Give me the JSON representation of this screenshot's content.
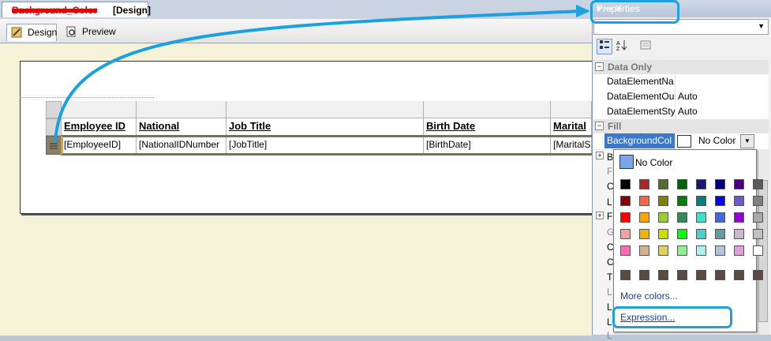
{
  "document": {
    "tab_redacted": "Background_Color",
    "tab_title": "[Design]"
  },
  "subtabs": {
    "design": "Design",
    "preview": "Preview"
  },
  "table": {
    "headers": [
      "Employee ID",
      "National",
      "Job Title",
      "Birth Date",
      "Marital"
    ],
    "cells": [
      "[EmployeeID]",
      "[NationalIDNumber",
      "[JobTitle]",
      "[BirthDate]",
      "[MaritalS"
    ]
  },
  "properties": {
    "title": "Properties",
    "pin_glyph": "▾ ⊸ ✕",
    "combo_arrow": "▼",
    "categories": {
      "data_only": "Data Only",
      "fill": "Fill"
    },
    "rows": [
      {
        "name": "DataElementNa",
        "value": ""
      },
      {
        "name": "DataElementOu",
        "value": "Auto"
      },
      {
        "name": "DataElementSty",
        "value": "Auto"
      }
    ],
    "background_row": {
      "name": "BackgroundCol",
      "value": "No Color"
    },
    "collapsed_letters": [
      "B",
      "F",
      "C",
      "L",
      "F",
      "G",
      "C",
      "C",
      "T",
      "L",
      "L",
      "L",
      "L"
    ]
  },
  "picker": {
    "no_color": "No Color",
    "more_colors": "More colors...",
    "expression": "Expression...",
    "swatches": [
      [
        "#000000",
        "#a52a2a",
        "#556b2f",
        "#006400",
        "#191970",
        "#000080",
        "#4b0082",
        "#595959"
      ],
      [
        "#8b0000",
        "#ff6347",
        "#808000",
        "#008000",
        "#008080",
        "#0000ff",
        "#6a5acd",
        "#808080"
      ],
      [
        "#ff0000",
        "#ffa500",
        "#9acd32",
        "#2e8b57",
        "#40e0d0",
        "#4169e1",
        "#9400d3",
        "#a9a9a9"
      ],
      [
        "#f4a0a0",
        "#f0b400",
        "#ccdd00",
        "#00ff00",
        "#48d1cc",
        "#5f9ea0",
        "#cdb5cd",
        "#c0c0c0"
      ],
      [
        "#ff69b4",
        "#d2b48c",
        "#e0d060",
        "#90ee90",
        "#afeeee",
        "#b0c4de",
        "#dda0dd",
        "#ffffff"
      ],
      [
        "#5a4a40",
        "#5a4a40",
        "#5a4a40",
        "#5a4a40",
        "#5a4a40",
        "#5a4a40",
        "#5a4a40",
        "#5a4a40"
      ]
    ]
  },
  "colors": {
    "callout": "#1ba0e2",
    "selection": "#3b78c8",
    "designer_bg": "#f6f2d8"
  }
}
